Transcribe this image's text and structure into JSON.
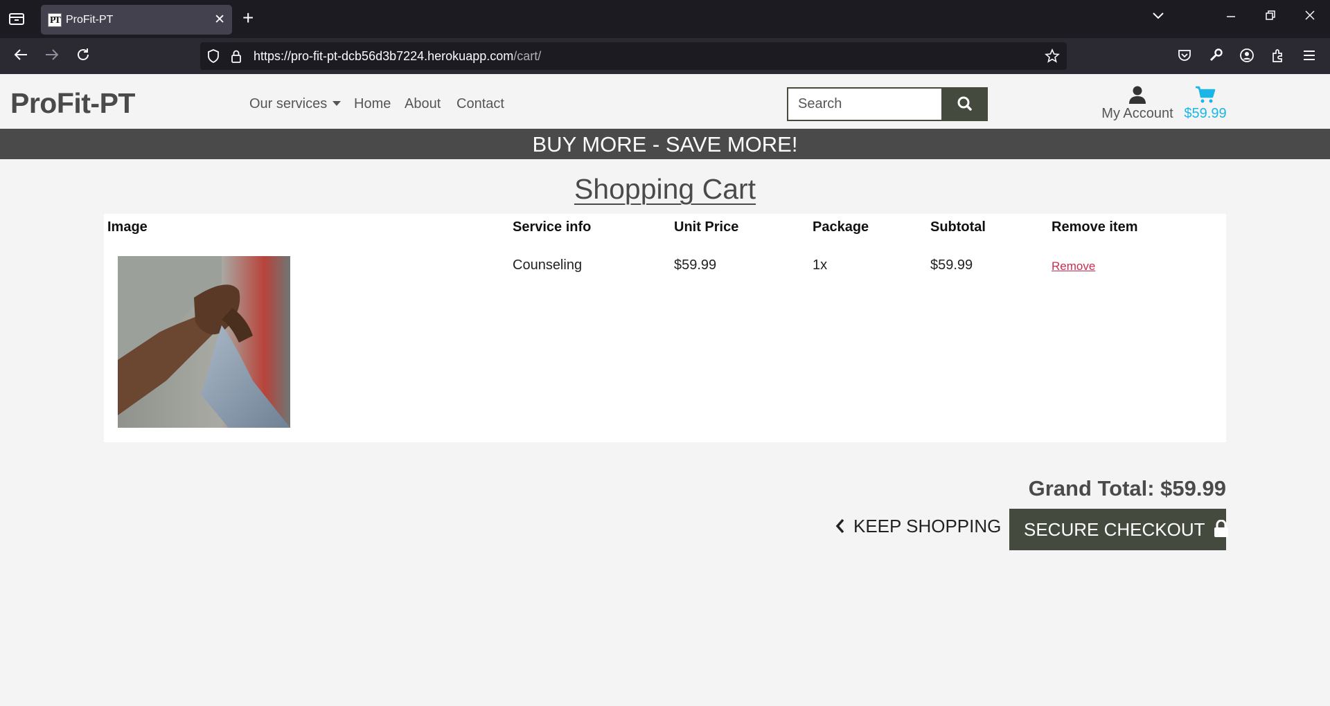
{
  "browser": {
    "tab_title": "ProFit-PT",
    "favicon_text": "PT",
    "url_host": "https://pro-fit-pt-dcb56d3b7224.herokuapp.com",
    "url_path": "/cart/"
  },
  "header": {
    "brand": "ProFit-PT",
    "nav": {
      "services": "Our services",
      "home": "Home",
      "about": "About",
      "contact": "Contact"
    },
    "search": {
      "placeholder": "Search"
    },
    "account_label": "My Account",
    "cart_total": "$59.99"
  },
  "banner": "BUY MORE - SAVE MORE!",
  "page_title": "Shopping Cart",
  "table": {
    "headers": [
      "Image",
      "Service info",
      "Unit Price",
      "Package",
      "Subtotal",
      "Remove item"
    ],
    "rows": [
      {
        "service": "Counseling",
        "unit_price": "$59.99",
        "package": "1x",
        "subtotal": "$59.99",
        "remove": "Remove"
      }
    ]
  },
  "summary": {
    "grand_total": "Grand Total: $59.99",
    "keep_shopping": "KEEP SHOPPING",
    "checkout": "SECURE CHECKOUT"
  },
  "colors": {
    "brand_dark": "#454a3f",
    "banner_bg": "#4a4a4a",
    "cart_accent": "#1ab6e8",
    "remove_link": "#cc2a4f"
  }
}
